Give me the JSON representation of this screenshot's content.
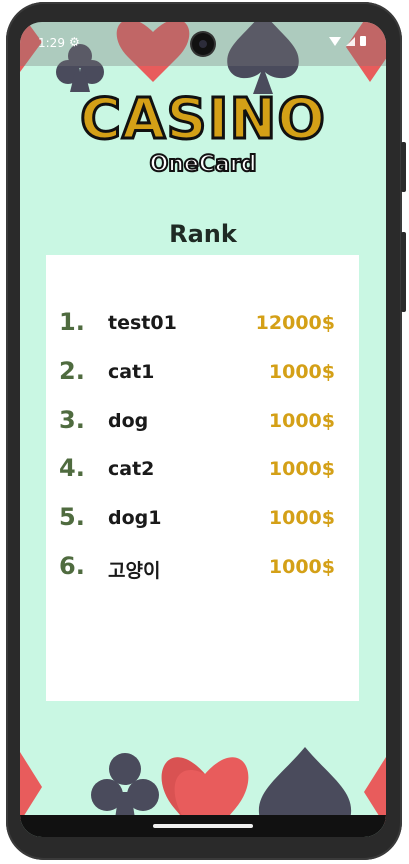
{
  "status_bar": {
    "time": "1:29",
    "settings_icon": "gear-icon",
    "wifi_icon": "wifi-icon",
    "signal_icon": "signal-icon",
    "battery_icon": "battery-icon"
  },
  "logo": {
    "title": "CASINO",
    "subtitle": "OneCard"
  },
  "rank": {
    "title": "Rank",
    "entries": [
      {
        "rank": "1.",
        "name": "test01",
        "money": "12000$"
      },
      {
        "rank": "2.",
        "name": "cat1",
        "money": "1000$"
      },
      {
        "rank": "3.",
        "name": "dog",
        "money": "1000$"
      },
      {
        "rank": "4.",
        "name": "cat2",
        "money": "1000$"
      },
      {
        "rank": "5.",
        "name": "dog1",
        "money": "1000$"
      },
      {
        "rank": "6.",
        "name": "고양이",
        "money": "1000$"
      }
    ]
  },
  "colors": {
    "background": "#c9f7e3",
    "gold": "#d4a017",
    "rank_number": "#4f6b3f",
    "suit_dark": "#4a4b5c",
    "suit_red": "#e85c5c"
  },
  "decorations": [
    "club-icon",
    "heart-icon",
    "spade-icon",
    "diamond-icon"
  ]
}
